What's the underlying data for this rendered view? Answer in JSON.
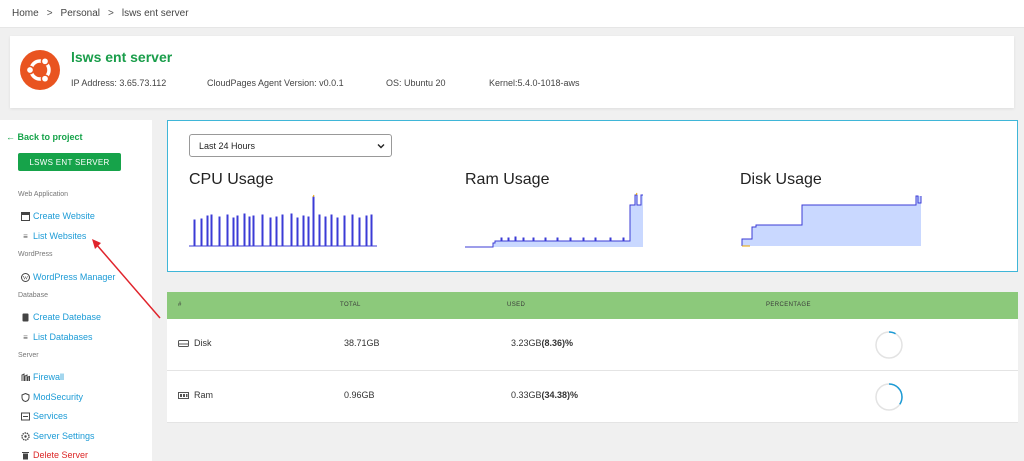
{
  "breadcrumb": {
    "items": [
      "Home",
      "Personal",
      "lsws ent server"
    ]
  },
  "server": {
    "name": "lsws ent server",
    "ip": "IP Address: 3.65.73.112",
    "agent": "CloudPages Agent Version: v0.0.1",
    "os": "OS: Ubuntu 20",
    "kernel": "Kernel:5.4.0-1018-aws"
  },
  "sidebar": {
    "back_label": "Back to project",
    "server_button": "LSWS ENT SERVER",
    "sections": {
      "web_app": "Web Application",
      "wordpress": "WordPress",
      "database": "Database",
      "server": "Server"
    },
    "items": {
      "create_website": "Create Website",
      "list_websites": "List Websites",
      "wordpress_manager": "WordPress Manager",
      "create_database": "Create Datebase",
      "list_databases": "List Databases",
      "firewall": "Firewall",
      "modsecurity": "ModSecurity",
      "services": "Services",
      "server_settings": "Server Settings",
      "delete_server": "Delete Server"
    }
  },
  "usage": {
    "range_selected": "Last 24 Hours",
    "cpu_title": "CPU Usage",
    "ram_title": "Ram Usage",
    "disk_title": "Disk Usage"
  },
  "table": {
    "headers": {
      "num": "#",
      "total": "TOTAL",
      "used": "USED",
      "percentage": "PERCENTAGE"
    },
    "rows": [
      {
        "name": "Disk",
        "total": "38.71GB",
        "used": "3.23GB",
        "percent": "(8.36)%",
        "fraction": 0.0836,
        "icon": "hard-drive-icon"
      },
      {
        "name": "Ram",
        "total": "0.96GB",
        "used": "0.33GB",
        "percent": "(34.38)%",
        "fraction": 0.3438,
        "icon": "memory-icon"
      }
    ]
  },
  "colors": {
    "accent_green": "#16a34a",
    "link_blue": "#1c9bd6",
    "danger_red": "#dc2626",
    "header_green": "#8cc97b",
    "chart_line": "#3b3bd6",
    "chart_fill": "#c9d8ff",
    "ubuntu_orange": "#e95420"
  }
}
